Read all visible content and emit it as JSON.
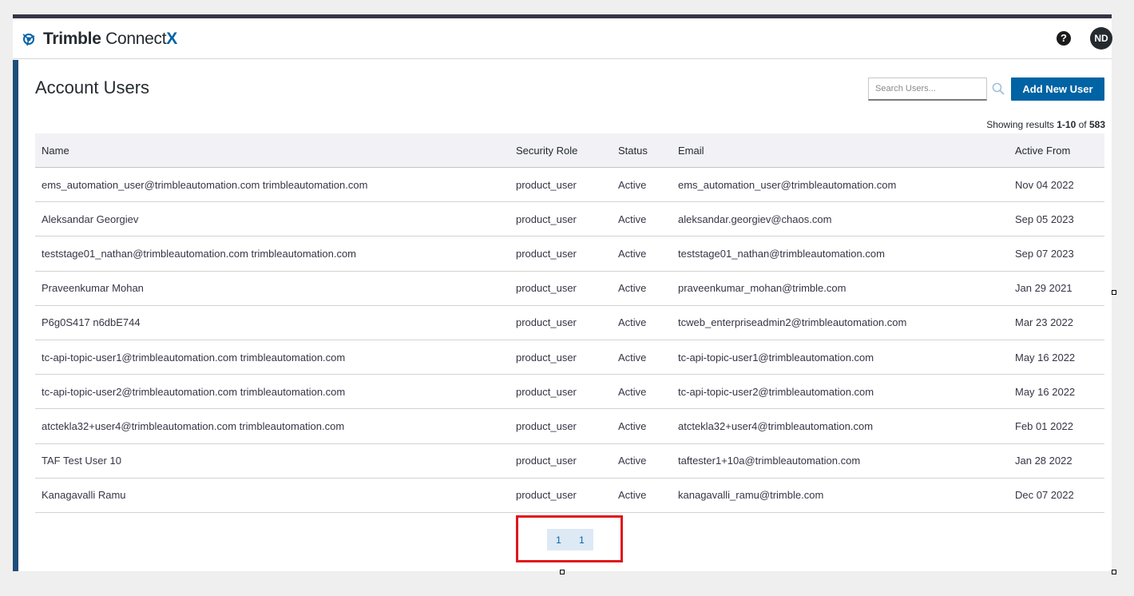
{
  "app": {
    "logo_bold": "Trimble",
    "logo_regular": " Connect",
    "logo_accent": "X",
    "help_label": "?",
    "avatar_initials": "ND"
  },
  "page": {
    "title": "Account Users"
  },
  "toolbar": {
    "search_placeholder": "Search Users...",
    "search_value": "",
    "add_user_label": "Add New User"
  },
  "results": {
    "prefix": "Showing results ",
    "range": "1-10",
    "of": " of ",
    "total": "583"
  },
  "table": {
    "columns": [
      "Name",
      "Security Role",
      "Status",
      "Email",
      "Active From"
    ],
    "rows": [
      [
        "ems_automation_user@trimbleautomation.com trimbleautomation.com",
        "product_user",
        "Active",
        "ems_automation_user@trimbleautomation.com",
        "Nov 04 2022"
      ],
      [
        "Aleksandar Georgiev",
        "product_user",
        "Active",
        "aleksandar.georgiev@chaos.com",
        "Sep 05 2023"
      ],
      [
        "teststage01_nathan@trimbleautomation.com trimbleautomation.com",
        "product_user",
        "Active",
        "teststage01_nathan@trimbleautomation.com",
        "Sep 07 2023"
      ],
      [
        "Praveenkumar Mohan",
        "product_user",
        "Active",
        "praveenkumar_mohan@trimble.com",
        "Jan 29 2021"
      ],
      [
        "P6g0S417 n6dbE744",
        "product_user",
        "Active",
        "tcweb_enterpriseadmin2@trimbleautomation.com",
        "Mar 23 2022"
      ],
      [
        "tc-api-topic-user1@trimbleautomation.com trimbleautomation.com",
        "product_user",
        "Active",
        "tc-api-topic-user1@trimbleautomation.com",
        "May 16 2022"
      ],
      [
        "tc-api-topic-user2@trimbleautomation.com trimbleautomation.com",
        "product_user",
        "Active",
        "tc-api-topic-user2@trimbleautomation.com",
        "May 16 2022"
      ],
      [
        "atctekla32+user4@trimbleautomation.com trimbleautomation.com",
        "product_user",
        "Active",
        "atctekla32+user4@trimbleautomation.com",
        "Feb 01 2022"
      ],
      [
        "TAF Test User 10",
        "product_user",
        "Active",
        "taftester1+10a@trimbleautomation.com",
        "Jan 28 2022"
      ],
      [
        "Kanagavalli Ramu",
        "product_user",
        "Active",
        "kanagavalli_ramu@trimble.com",
        "Dec 07 2022"
      ]
    ]
  },
  "pagination": {
    "items": [
      "1",
      "1"
    ]
  },
  "colors": {
    "accent": "#0063a3",
    "sidebar": "#1f4e79",
    "highlight": "#e0151b"
  },
  "icons": {
    "logo": "trimble-logo-icon",
    "search": "search-icon",
    "help": "help-icon"
  }
}
